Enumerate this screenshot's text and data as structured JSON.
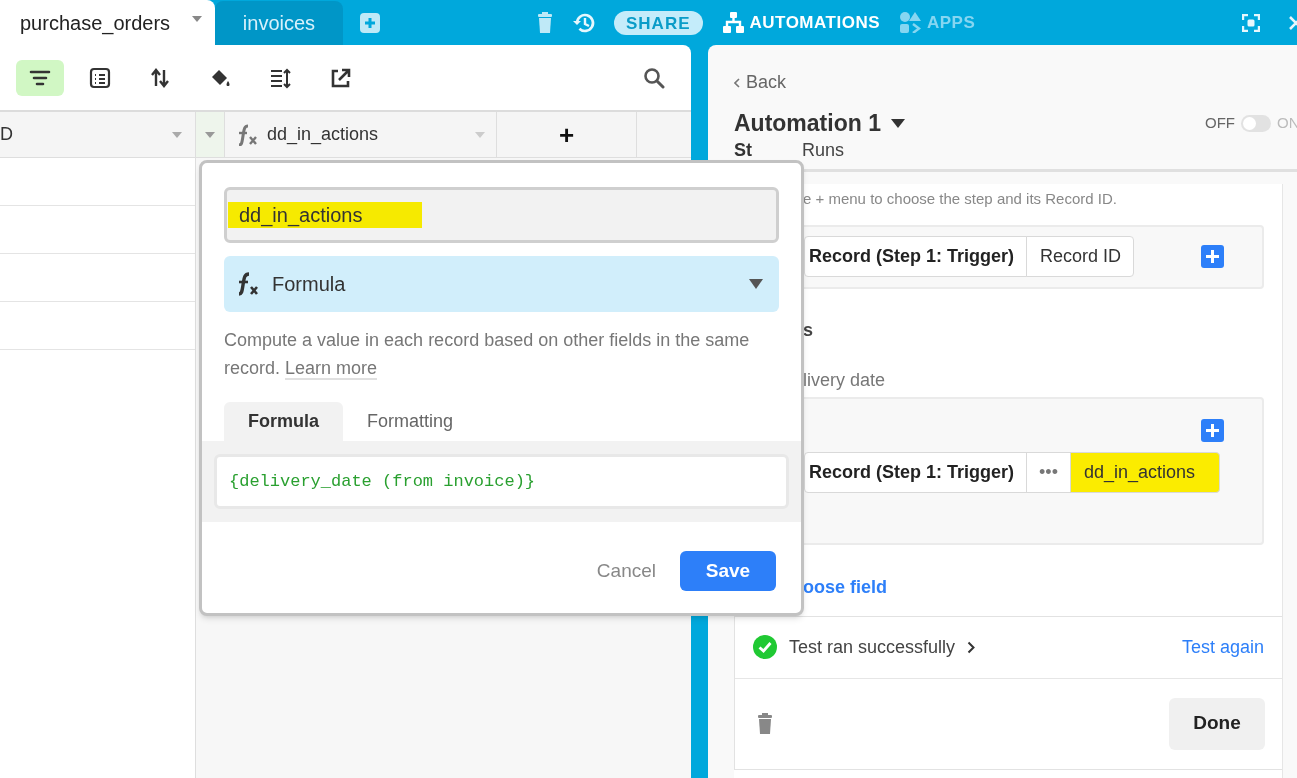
{
  "top_bar": {
    "tabs": [
      {
        "label": "purchase_orders",
        "selected": true
      },
      {
        "label": "invoices",
        "selected": false
      }
    ],
    "share": "SHARE",
    "sections": [
      {
        "label": "AUTOMATIONS",
        "selected": true,
        "kind": "automations"
      },
      {
        "label": "APPS",
        "selected": false,
        "kind": "apps"
      }
    ]
  },
  "toolbar": {
    "buttons": [
      {
        "kind": "filter",
        "selected": true
      },
      {
        "kind": "group",
        "selected": false
      },
      {
        "kind": "sort",
        "selected": false
      },
      {
        "kind": "color",
        "selected": false
      },
      {
        "kind": "height",
        "selected": false
      },
      {
        "kind": "share",
        "selected": false
      }
    ]
  },
  "grid": {
    "columns": [
      {
        "kind": "text",
        "label": "D"
      },
      {
        "kind": "caret"
      },
      {
        "kind": "formula",
        "label": "dd_in_actions"
      },
      {
        "kind": "add",
        "label": "+"
      }
    ]
  },
  "field_popup": {
    "name": "dd_in_actions",
    "name_highlighted": true,
    "type": "Formula",
    "description": "Compute a value in each record based on other fields in the same record.",
    "learn_more": "Learn more",
    "tabs": [
      {
        "label": "Formula",
        "selected": true
      },
      {
        "label": "Formatting",
        "selected": false
      }
    ],
    "formula": "{delivery_date (from invoice)}",
    "cancel": "Cancel",
    "save": "Save"
  },
  "automation": {
    "back": "Back",
    "title": "Automation 1",
    "toggle": {
      "off_label": "OFF",
      "on_label": "ON",
      "on": false
    },
    "tabs": [
      {
        "label": "St",
        "selected": true
      },
      {
        "label": "Runs",
        "selected": false
      }
    ],
    "hint": "e + menu to choose the step and its Record ID.",
    "record_box": {
      "pills": [
        {
          "kind": "text",
          "label": "Record (Step 1: Trigger)",
          "highlighted": false
        },
        {
          "kind": "text",
          "label": "Record ID",
          "highlighted": false
        }
      ]
    },
    "section_label": "s",
    "field_label": "livery date",
    "value_box": {
      "pills": [
        {
          "kind": "text",
          "label": "Record (Step 1: Trigger)",
          "highlighted": false
        },
        {
          "kind": "more",
          "label": "•••"
        },
        {
          "kind": "text",
          "label": "dd_in_actions",
          "highlighted": true
        }
      ]
    },
    "choose_field": "oose field",
    "test_status": "Test ran successfully",
    "test_again": "Test again",
    "done": "Done"
  }
}
